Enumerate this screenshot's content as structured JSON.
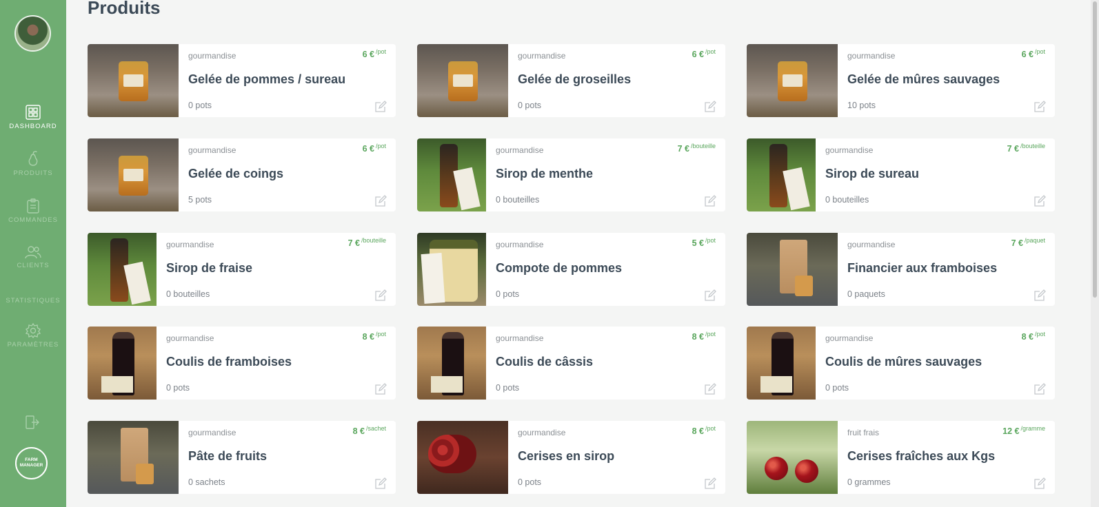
{
  "colors": {
    "sidebar": "#6fad72",
    "accent": "#5aa65d",
    "title": "#3c4a57",
    "background": "#f4f5f4"
  },
  "sidebar": {
    "items": [
      {
        "label": "Dashboard",
        "icon": "dashboard-icon",
        "active": true
      },
      {
        "label": "Produits",
        "icon": "pear-icon",
        "active": false
      },
      {
        "label": "Commandes",
        "icon": "clipboard-icon",
        "active": false
      },
      {
        "label": "Clients",
        "icon": "users-icon",
        "active": false
      },
      {
        "label": "Statistiques",
        "icon": "",
        "active": false
      },
      {
        "label": "Paramètres",
        "icon": "gear-icon",
        "active": false
      }
    ],
    "logo_text": "FARM MANAGER",
    "logout_icon": "logout-icon"
  },
  "page": {
    "title": "Produits"
  },
  "products": [
    {
      "category": "gourmandise",
      "name": "Gelée de pommes / sureau",
      "price": "6 €",
      "unit": "/pot",
      "stock": "0 pots",
      "image": "jar"
    },
    {
      "category": "gourmandise",
      "name": "Gelée de groseilles",
      "price": "6 €",
      "unit": "/pot",
      "stock": "0 pots",
      "image": "jar"
    },
    {
      "category": "gourmandise",
      "name": "Gelée de mûres sauvages",
      "price": "6 €",
      "unit": "/pot",
      "stock": "10 pots",
      "image": "jar"
    },
    {
      "category": "gourmandise",
      "name": "Gelée de coings",
      "price": "6 €",
      "unit": "/pot",
      "stock": "5 pots",
      "image": "jar"
    },
    {
      "category": "gourmandise",
      "name": "Sirop de menthe",
      "price": "7 €",
      "unit": "/bouteille",
      "stock": "0 bouteilles",
      "image": "bottle-grass"
    },
    {
      "category": "gourmandise",
      "name": "Sirop de sureau",
      "price": "7 €",
      "unit": "/bouteille",
      "stock": "0 bouteilles",
      "image": "bottle-grass"
    },
    {
      "category": "gourmandise",
      "name": "Sirop de fraise",
      "price": "7 €",
      "unit": "/bouteille",
      "stock": "0 bouteilles",
      "image": "bottle-grass"
    },
    {
      "category": "gourmandise",
      "name": "Compote de pommes",
      "price": "5 €",
      "unit": "/pot",
      "stock": "0 pots",
      "image": "compote"
    },
    {
      "category": "gourmandise",
      "name": "Financier aux framboises",
      "price": "7 €",
      "unit": "/paquet",
      "stock": "0 paquets",
      "image": "bag"
    },
    {
      "category": "gourmandise",
      "name": "Coulis de framboises",
      "price": "8 €",
      "unit": "/pot",
      "stock": "0 pots",
      "image": "coulis"
    },
    {
      "category": "gourmandise",
      "name": "Coulis de câssis",
      "price": "8 €",
      "unit": "/pot",
      "stock": "0 pots",
      "image": "coulis"
    },
    {
      "category": "gourmandise",
      "name": "Coulis de mûres sauvages",
      "price": "8 €",
      "unit": "/pot",
      "stock": "0 pots",
      "image": "coulis"
    },
    {
      "category": "gourmandise",
      "name": "Pâte de fruits",
      "price": "8 €",
      "unit": "/sachet",
      "stock": "0 sachets",
      "image": "bag"
    },
    {
      "category": "gourmandise",
      "name": "Cerises en sirop",
      "price": "8 €",
      "unit": "/pot",
      "stock": "0 pots",
      "image": "cherries-bowl"
    },
    {
      "category": "fruit frais",
      "name": "Cerises fraîches aux Kgs",
      "price": "12 €",
      "unit": "/gramme",
      "stock": "0 grammes",
      "image": "cherries-fresh"
    }
  ]
}
